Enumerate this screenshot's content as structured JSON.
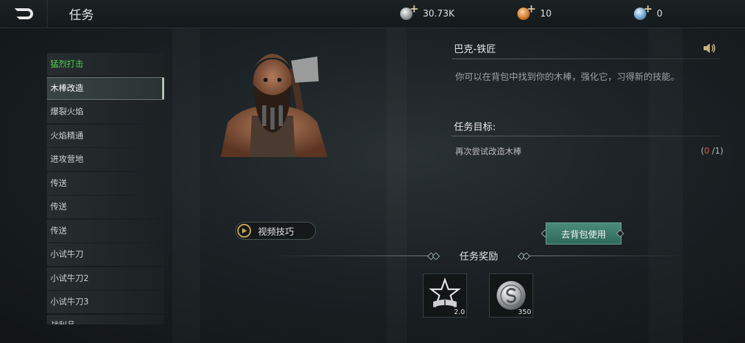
{
  "header": {
    "title": "任务",
    "currencies": [
      {
        "icon": "silver-coin-icon",
        "value": "30.73K"
      },
      {
        "icon": "gold-coin-icon",
        "value": "10"
      },
      {
        "icon": "gem-icon",
        "value": "0"
      }
    ]
  },
  "sidebar": {
    "items": [
      {
        "label": "猛烈打击"
      },
      {
        "label": "木棒改造"
      },
      {
        "label": "爆裂火焰"
      },
      {
        "label": "火焰精通"
      },
      {
        "label": "进攻营地"
      },
      {
        "label": "传送"
      },
      {
        "label": "传送"
      },
      {
        "label": "传送"
      },
      {
        "label": "小试牛刀"
      },
      {
        "label": "小试牛刀2"
      },
      {
        "label": "小试牛刀3"
      },
      {
        "label": "战利品"
      }
    ]
  },
  "npc": {
    "name": "巴克-铁匠",
    "description": "你可以在背包中找到你的木棒，强化它，习得新的技能。"
  },
  "objective": {
    "title": "任务目标:",
    "text": "再次尝试改造木棒",
    "progress_current": "0",
    "progress_total": "/1)",
    "progress_open": "("
  },
  "buttons": {
    "video": "视频技巧",
    "use": "去背包使用"
  },
  "rewards": {
    "title": "任务奖励",
    "items": [
      {
        "icon": "skill-book-icon",
        "count": "2.0"
      },
      {
        "icon": "silver-coin-icon",
        "count": "350"
      }
    ]
  },
  "colors": {
    "accent_green": "#4fd34f",
    "button_teal": "#3f7f6f",
    "progress_red": "#e8543c"
  }
}
